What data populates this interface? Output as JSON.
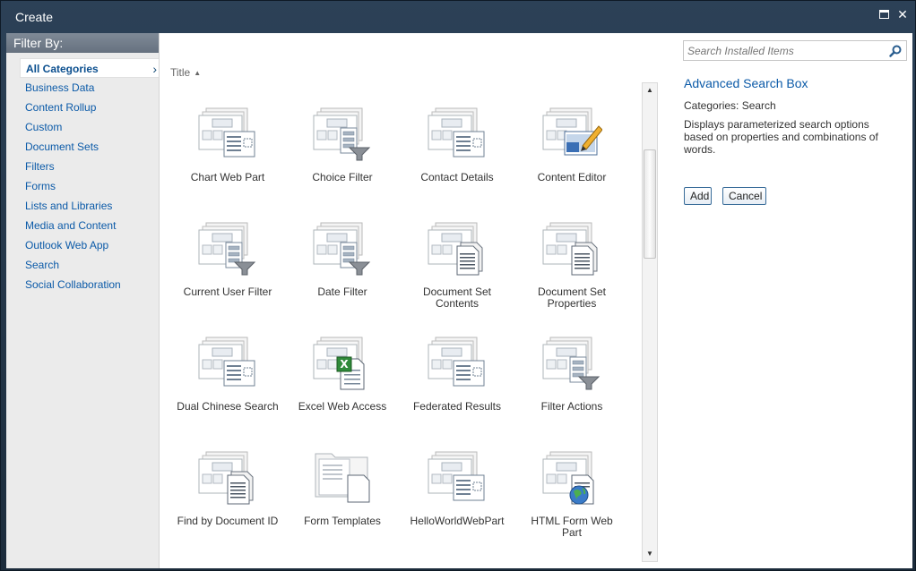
{
  "dialog": {
    "title": "Create",
    "maximize_icon": "maximize-icon",
    "close_glyph": "✕"
  },
  "filter": {
    "header": "Filter By:",
    "categories": [
      {
        "label": "All Categories",
        "selected": true
      },
      {
        "label": "Business Data"
      },
      {
        "label": "Content Rollup"
      },
      {
        "label": "Custom"
      },
      {
        "label": "Document Sets"
      },
      {
        "label": "Filters"
      },
      {
        "label": "Forms"
      },
      {
        "label": "Lists and Libraries"
      },
      {
        "label": "Media and Content"
      },
      {
        "label": "Outlook Web App"
      },
      {
        "label": "Search"
      },
      {
        "label": "Social Collaboration"
      }
    ]
  },
  "gallery": {
    "sort_label": "Title",
    "sort_direction": "ascending",
    "items": [
      {
        "label": "Chart Web Part",
        "icon": "webpart-list-icon"
      },
      {
        "label": "Choice Filter",
        "icon": "filter-icon"
      },
      {
        "label": "Contact Details",
        "icon": "webpart-list-icon"
      },
      {
        "label": "Content Editor",
        "icon": "pencil-icon"
      },
      {
        "label": "Current User Filter",
        "icon": "filter-icon"
      },
      {
        "label": "Date Filter",
        "icon": "filter-icon"
      },
      {
        "label": "Document Set Contents",
        "icon": "document-icon"
      },
      {
        "label": "Document Set Properties",
        "icon": "document-icon"
      },
      {
        "label": "Dual Chinese Search",
        "icon": "webpart-list-icon"
      },
      {
        "label": "Excel Web Access",
        "icon": "excel-icon"
      },
      {
        "label": "Federated Results",
        "icon": "webpart-list-icon"
      },
      {
        "label": "Filter Actions",
        "icon": "filter-icon"
      },
      {
        "label": "Find by Document ID",
        "icon": "document-icon"
      },
      {
        "label": "Form Templates",
        "icon": "form-library-icon"
      },
      {
        "label": "HelloWorldWebPart",
        "icon": "webpart-list-icon"
      },
      {
        "label": "HTML Form Web Part",
        "icon": "globe-icon"
      }
    ]
  },
  "detail": {
    "search_placeholder": "Search Installed Items",
    "title": "Advanced Search Box",
    "categories": "Categories: Search",
    "description": "Displays parameterized search options based on properties and combinations of words.",
    "add_label": "Add",
    "cancel_label": "Cancel"
  },
  "colors": {
    "link": "#0b5aa8",
    "header_bg": "#2c4157",
    "filter_header_bg": "#737e8c"
  }
}
